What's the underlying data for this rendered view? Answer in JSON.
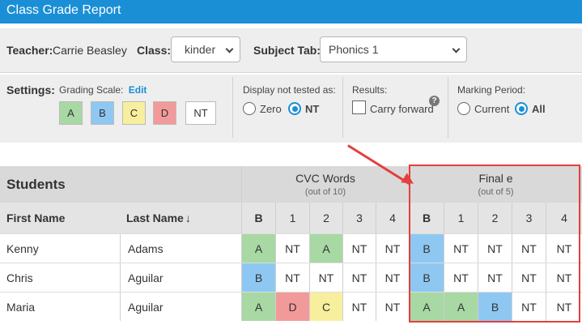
{
  "title": "Class Grade Report",
  "topbar": {
    "teacher_label": "Teacher:",
    "teacher_name": "Carrie Beasley",
    "class_label": "Class:",
    "class_value": "kinder",
    "subject_label": "Subject Tab:",
    "subject_value": "Phonics 1"
  },
  "settings": {
    "label": "Settings:",
    "grading_scale_label": "Grading Scale:",
    "edit_link": "Edit",
    "scale": [
      "A",
      "B",
      "C",
      "D",
      "NT"
    ],
    "display_label": "Display not tested as:",
    "display_options": [
      "Zero",
      "NT"
    ],
    "display_selected": "NT",
    "results_label": "Results:",
    "carry_forward_label": "Carry forward",
    "carry_forward_checked": false,
    "marking_label": "Marking Period:",
    "marking_options": [
      "Current",
      "All"
    ],
    "marking_selected": "All"
  },
  "table": {
    "students_header": "Students",
    "first_name_header": "First Name",
    "last_name_header": "Last Name",
    "groups": [
      {
        "name": "CVC Words",
        "subtitle": "(out of 10)",
        "columns": [
          "B",
          "1",
          "2",
          "3",
          "4"
        ]
      },
      {
        "name": "Final e",
        "subtitle": "(out of 5)",
        "columns": [
          "B",
          "1",
          "2",
          "3",
          "4"
        ]
      }
    ],
    "rows": [
      {
        "first": "Kenny",
        "last": "Adams",
        "grades": [
          "A",
          "NT",
          "A",
          "NT",
          "NT",
          "B",
          "NT",
          "NT",
          "NT",
          "NT"
        ]
      },
      {
        "first": "Chris",
        "last": "Aguilar",
        "grades": [
          "B",
          "NT",
          "NT",
          "NT",
          "NT",
          "B",
          "NT",
          "NT",
          "NT",
          "NT"
        ]
      },
      {
        "first": "Maria",
        "last": "Aguilar",
        "grades": [
          "A",
          "D",
          "C",
          "NT",
          "NT",
          "A",
          "A",
          "B",
          "NT",
          "NT"
        ]
      }
    ]
  },
  "colors": {
    "accent": "#1a8fd6",
    "A": "#a8d8a4",
    "B": "#8ec8f2",
    "C": "#f8ef9e",
    "D": "#f29a9a",
    "highlight": "#e53e3e"
  }
}
